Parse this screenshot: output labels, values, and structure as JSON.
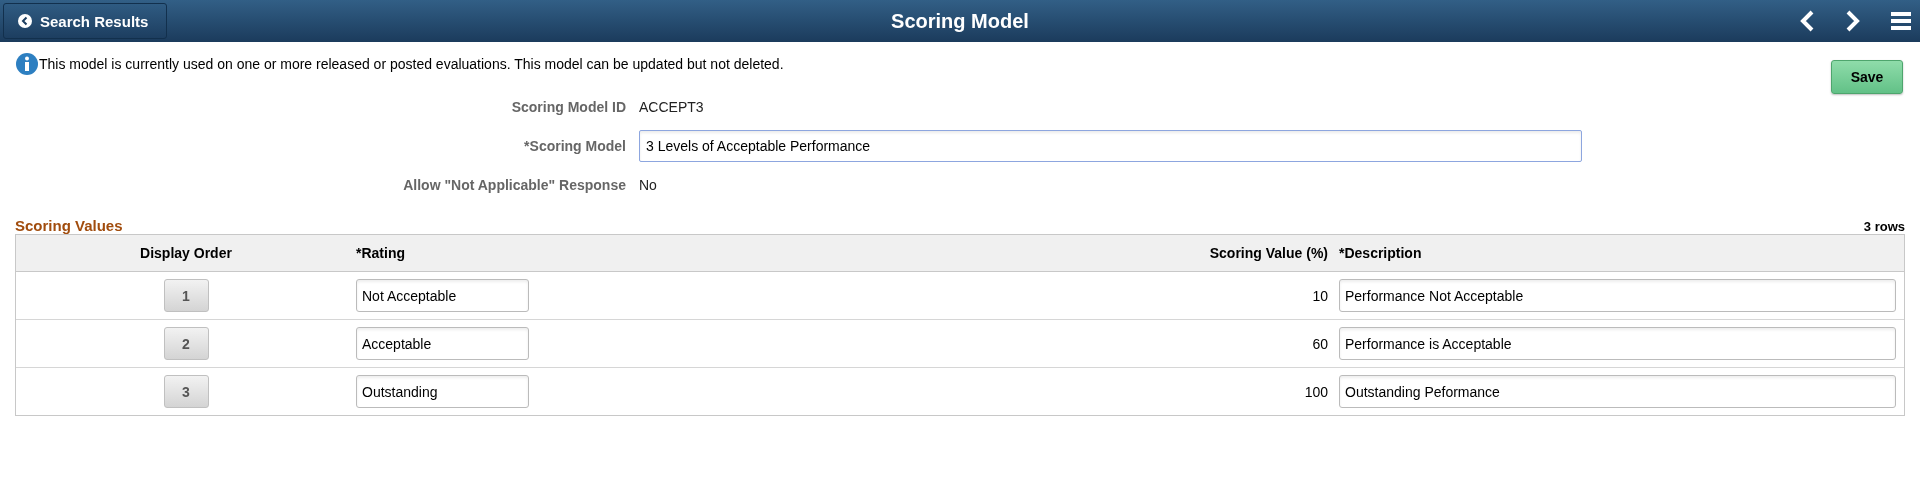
{
  "header": {
    "back_button": "Search Results",
    "title": "Scoring Model"
  },
  "message": "This model is currently used on one or more released or posted evaluations. This model can be updated but not deleted.",
  "save_button": "Save",
  "fields": [
    {
      "kind": "text",
      "label": "Scoring Model ID",
      "value": "ACCEPT3"
    },
    {
      "kind": "input",
      "label": "*Scoring Model",
      "value": "3 Levels of Acceptable Performance"
    },
    {
      "kind": "text",
      "label": "Allow \"Not Applicable\" Response",
      "value": "No"
    }
  ],
  "scoring_values": {
    "title": "Scoring Values",
    "row_count": "3 rows",
    "columns": [
      "Display Order",
      "*Rating",
      "Scoring Value (%)",
      "*Description"
    ],
    "rows": [
      {
        "display_order": "1",
        "rating": "Not Acceptable",
        "scoring_value": "10",
        "description": "Performance Not Acceptable"
      },
      {
        "display_order": "2",
        "rating": "Acceptable",
        "scoring_value": "60",
        "description": "Performance is Acceptable"
      },
      {
        "display_order": "3",
        "rating": "Outstanding",
        "scoring_value": "100",
        "description": "Outstanding Peformance"
      }
    ]
  }
}
